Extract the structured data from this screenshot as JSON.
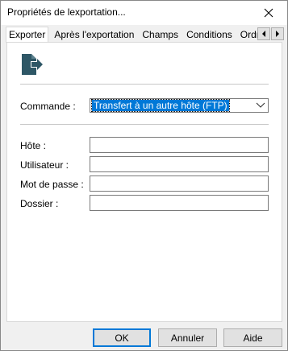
{
  "window": {
    "title": "Propriétés de lexportation...",
    "close_glyph": "✕"
  },
  "tabs": [
    {
      "label": "Exporter",
      "active": true
    },
    {
      "label": "Après l'exportation",
      "active": false
    },
    {
      "label": "Champs",
      "active": false
    },
    {
      "label": "Conditions",
      "active": false
    },
    {
      "label": "Ordre de tri",
      "active": false
    }
  ],
  "tab_scroll": {
    "left_glyph": "◀",
    "right_glyph": "▶"
  },
  "header_icon": {
    "name": "export-icon",
    "color": "#2e5766"
  },
  "command": {
    "label": "Commande :",
    "selected": "Transfert à un autre hôte (FTP)"
  },
  "form": {
    "host_label": "Hôte :",
    "host_value": "",
    "user_label": "Utilisateur :",
    "user_value": "",
    "password_label": "Mot de passe :",
    "password_value": "",
    "folder_label": "Dossier :",
    "folder_value": ""
  },
  "buttons": {
    "ok": "OK",
    "cancel": "Annuler",
    "help": "Aide"
  },
  "colors": {
    "accent": "#0078d7",
    "dialog_bg": "#f0f0f0",
    "panel_bg": "#ffffff"
  }
}
